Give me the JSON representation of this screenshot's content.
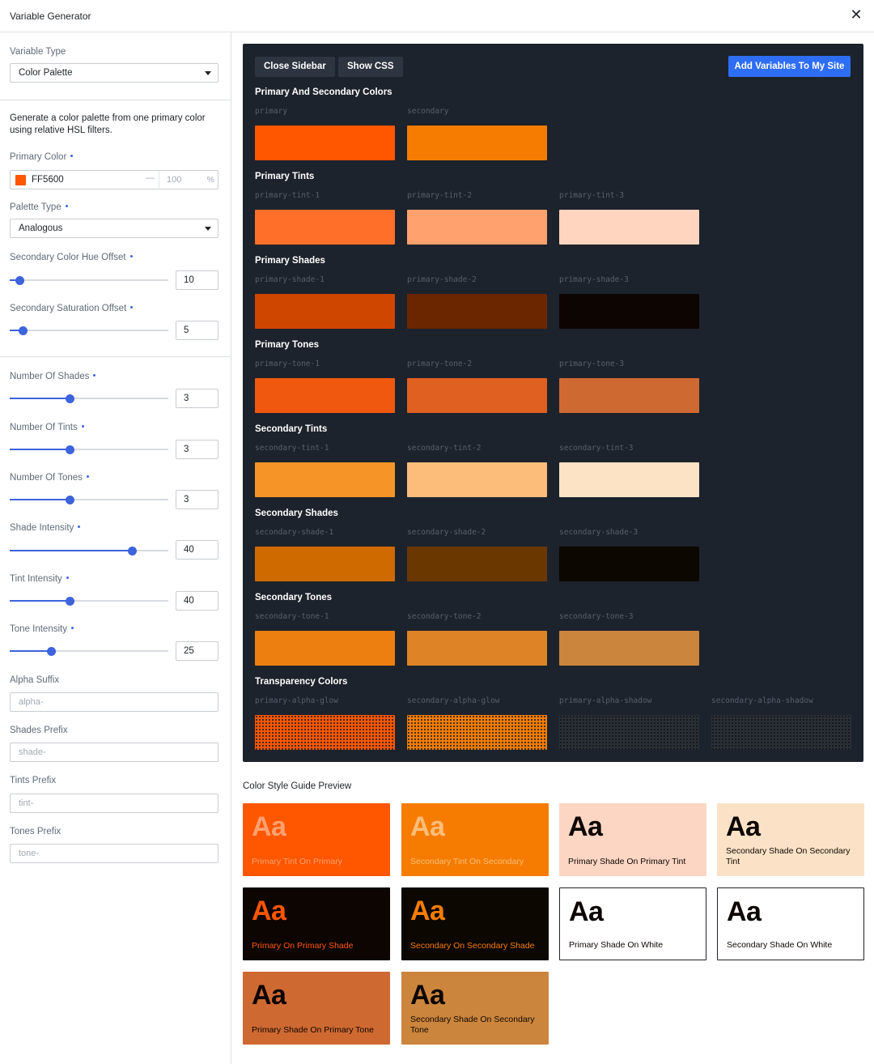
{
  "window": {
    "title": "Variable Generator",
    "close_glyph": "✕"
  },
  "sidebar": {
    "variable_type": {
      "label": "Variable Type",
      "value": "Color Palette"
    },
    "description": "Generate a color palette from one primary color using relative HSL filters.",
    "primary_color": {
      "label": "Primary Color",
      "hex": "FF5600",
      "swatch": "#ff5600",
      "dash": "—",
      "alpha_placeholder": "100",
      "alpha_unit": "%"
    },
    "palette_type": {
      "label": "Palette Type",
      "value": "Analogous"
    },
    "hue_offset": {
      "label": "Secondary Color Hue Offset",
      "value": "10",
      "fraction": 0.06
    },
    "saturation_offset": {
      "label": "Secondary Saturation Offset",
      "value": "5",
      "fraction": 0.08
    },
    "num_shades": {
      "label": "Number Of Shades",
      "value": "3",
      "fraction": 0.38
    },
    "num_tints": {
      "label": "Number Of Tints",
      "value": "3",
      "fraction": 0.38
    },
    "num_tones": {
      "label": "Number Of Tones",
      "value": "3",
      "fraction": 0.38
    },
    "shade_intensity": {
      "label": "Shade Intensity",
      "value": "40",
      "fraction": 0.77
    },
    "tint_intensity": {
      "label": "Tint Intensity",
      "value": "40",
      "fraction": 0.38
    },
    "tone_intensity": {
      "label": "Tone Intensity",
      "value": "25",
      "fraction": 0.26
    },
    "alpha_suffix": {
      "label": "Alpha Suffix",
      "placeholder": "alpha-"
    },
    "shades_prefix": {
      "label": "Shades Prefix",
      "placeholder": "shade-"
    },
    "tints_prefix": {
      "label": "Tints Prefix",
      "placeholder": "tint-"
    },
    "tones_prefix": {
      "label": "Tones Prefix",
      "placeholder": "tone-"
    }
  },
  "panel": {
    "close_sidebar": "Close Sidebar",
    "show_css": "Show CSS",
    "add_variables": "Add Variables To My Site",
    "sections": [
      {
        "title": "Primary And Secondary Colors",
        "vars": [
          {
            "name": "primary",
            "color": "#ff5600"
          },
          {
            "name": "secondary",
            "color": "#f57c00"
          }
        ]
      },
      {
        "title": "Primary Tints",
        "vars": [
          {
            "name": "primary-tint-1",
            "color": "#ff6f29"
          },
          {
            "name": "primary-tint-2",
            "color": "#ffa06f"
          },
          {
            "name": "primary-tint-3",
            "color": "#ffd5bf"
          }
        ]
      },
      {
        "title": "Primary Shades",
        "vars": [
          {
            "name": "primary-shade-1",
            "color": "#cf4600"
          },
          {
            "name": "primary-shade-2",
            "color": "#6b2600"
          },
          {
            "name": "primary-shade-3",
            "color": "#0d0502"
          }
        ]
      },
      {
        "title": "Primary Tones",
        "vars": [
          {
            "name": "primary-tone-1",
            "color": "#f0580f"
          },
          {
            "name": "primary-tone-2",
            "color": "#e06021"
          },
          {
            "name": "primary-tone-3",
            "color": "#cf6932"
          }
        ]
      },
      {
        "title": "Secondary Tints",
        "vars": [
          {
            "name": "secondary-tint-1",
            "color": "#f79427"
          },
          {
            "name": "secondary-tint-2",
            "color": "#fbbd79"
          },
          {
            "name": "secondary-tint-3",
            "color": "#fde3c6"
          }
        ]
      },
      {
        "title": "Secondary Shades",
        "vars": [
          {
            "name": "secondary-shade-1",
            "color": "#cf6a00"
          },
          {
            "name": "secondary-shade-2",
            "color": "#6b3700"
          },
          {
            "name": "secondary-shade-3",
            "color": "#0d0702"
          }
        ]
      },
      {
        "title": "Secondary Tones",
        "vars": [
          {
            "name": "secondary-tone-1",
            "color": "#ec7f10"
          },
          {
            "name": "secondary-tone-2",
            "color": "#de8427"
          },
          {
            "name": "secondary-tone-3",
            "color": "#cc853d"
          }
        ]
      },
      {
        "title": "Transparency Colors",
        "vars": [
          {
            "name": "primary-alpha-glow",
            "color": "checker-a"
          },
          {
            "name": "secondary-alpha-glow",
            "color": "checker-b"
          },
          {
            "name": "primary-alpha-shadow",
            "color": "checker-c"
          },
          {
            "name": "secondary-alpha-shadow",
            "color": "checker-c"
          }
        ]
      }
    ]
  },
  "style_guide": {
    "title": "Color Style Guide Preview",
    "cards": [
      {
        "aa": "Aa",
        "caption": "Primary Tint On Primary",
        "bg": "#ff5600",
        "fg": "#ffa06f",
        "border": ""
      },
      {
        "aa": "Aa",
        "caption": "Secondary Tint On Secondary",
        "bg": "#f57c00",
        "fg": "#fbbd79",
        "border": ""
      },
      {
        "aa": "Aa",
        "caption": "Primary Shade On Primary Tint",
        "bg": "#fcd6c3",
        "fg": "#0d0502",
        "border": ""
      },
      {
        "aa": "Aa",
        "caption": "Secondary Shade On Secondary Tint",
        "bg": "#fbe2c6",
        "fg": "#0d0702",
        "border": ""
      },
      {
        "aa": "Aa",
        "caption": "Primary On Primary Shade",
        "bg": "#0d0502",
        "fg": "#ff5600",
        "border": ""
      },
      {
        "aa": "Aa",
        "caption": "Secondary On Secondary Shade",
        "bg": "#0d0702",
        "fg": "#f57c00",
        "border": ""
      },
      {
        "aa": "Aa",
        "caption": "Primary Shade On White",
        "bg": "#ffffff",
        "fg": "#0d0502",
        "border": "#1f2328"
      },
      {
        "aa": "Aa",
        "caption": "Secondary Shade On White",
        "bg": "#ffffff",
        "fg": "#0d0702",
        "border": "#1f2328"
      },
      {
        "aa": "Aa",
        "caption": "Primary Shade On Primary Tone",
        "bg": "#cf6932",
        "fg": "#0d0502",
        "border": ""
      },
      {
        "aa": "Aa",
        "caption": "Secondary Shade On Secondary Tone",
        "bg": "#cc853d",
        "fg": "#0d0702",
        "border": ""
      }
    ]
  }
}
